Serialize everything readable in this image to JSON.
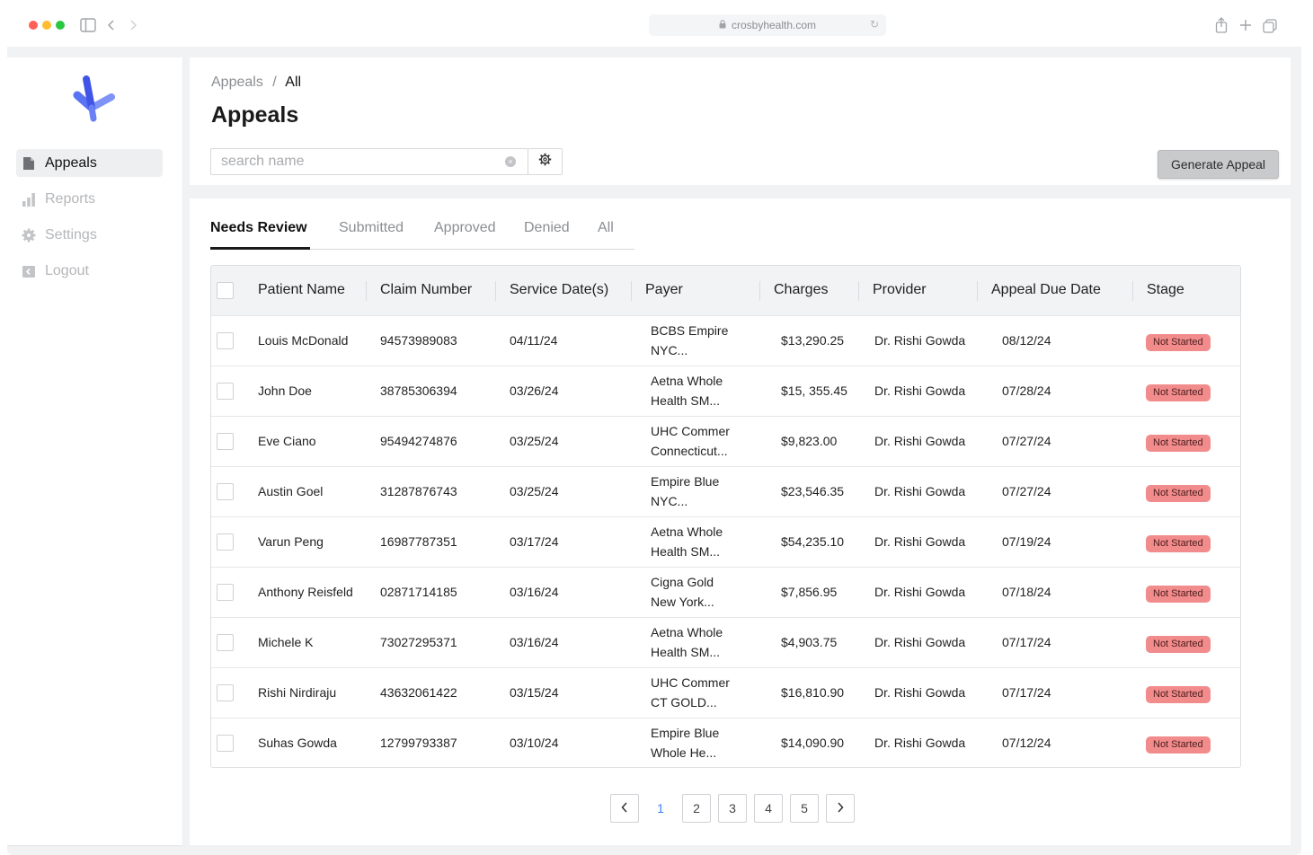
{
  "browser": {
    "url": "crosbyhealth.com"
  },
  "sidebar": {
    "items": [
      {
        "label": "Appeals",
        "icon": "file-icon",
        "active": true
      },
      {
        "label": "Reports",
        "icon": "bar-chart-icon"
      },
      {
        "label": "Settings",
        "icon": "gear-icon"
      },
      {
        "label": "Logout",
        "icon": "logout-icon"
      }
    ]
  },
  "header": {
    "breadcrumb": {
      "parent": "Appeals",
      "separator": "/",
      "current": "All"
    },
    "title": "Appeals",
    "search": {
      "placeholder": "search name",
      "value": ""
    },
    "generate_label": "Generate Appeal"
  },
  "tabs": [
    "Needs Review",
    "Submitted",
    "Approved",
    "Denied",
    "All"
  ],
  "active_tab": "Needs Review",
  "table": {
    "columns": [
      "Patient Name",
      "Claim Number",
      "Service Date(s)",
      "Payer",
      "Charges",
      "Provider",
      "Appeal Due Date",
      "Stage"
    ],
    "rows": [
      {
        "patient": "Louis McDonald",
        "claim": "94573989083",
        "service": "04/11/24",
        "payer": "BCBS Empire\nNYC...",
        "charges": "$13,290.25",
        "provider": "Dr. Rishi Gowda",
        "due": "08/12/24",
        "stage": "Not Started"
      },
      {
        "patient": "John Doe",
        "claim": "38785306394",
        "service": "03/26/24",
        "payer": "Aetna Whole\nHealth SM...",
        "charges": "$15, 355.45",
        "provider": "Dr. Rishi Gowda",
        "due": "07/28/24",
        "stage": "Not Started"
      },
      {
        "patient": "Eve Ciano",
        "claim": "95494274876",
        "service": "03/25/24",
        "payer": "UHC Commer\nConnecticut...",
        "charges": "$9,823.00",
        "provider": "Dr. Rishi Gowda",
        "due": "07/27/24",
        "stage": "Not Started"
      },
      {
        "patient": "Austin Goel",
        "claim": "31287876743",
        "service": "03/25/24",
        "payer": "Empire Blue\nNYC...",
        "charges": "$23,546.35",
        "provider": "Dr. Rishi Gowda",
        "due": "07/27/24",
        "stage": "Not Started"
      },
      {
        "patient": "Varun Peng",
        "claim": "16987787351",
        "service": "03/17/24",
        "payer": "Aetna Whole\nHealth SM...",
        "charges": "$54,235.10",
        "provider": "Dr. Rishi Gowda",
        "due": "07/19/24",
        "stage": "Not Started"
      },
      {
        "patient": "Anthony Reisfeld",
        "claim": "02871714185",
        "service": "03/16/24",
        "payer": "Cigna Gold\nNew York...",
        "charges": "$7,856.95",
        "provider": "Dr. Rishi Gowda",
        "due": "07/18/24",
        "stage": "Not Started"
      },
      {
        "patient": "Michele K",
        "claim": "73027295371",
        "service": "03/16/24",
        "payer": "Aetna Whole\nHealth SM...",
        "charges": "$4,903.75",
        "provider": "Dr. Rishi Gowda",
        "due": "07/17/24",
        "stage": "Not Started"
      },
      {
        "patient": "Rishi Nirdiraju",
        "claim": "43632061422",
        "service": "03/15/24",
        "payer": "UHC Commer\nCT GOLD...",
        "charges": "$16,810.90",
        "provider": "Dr. Rishi Gowda",
        "due": "07/17/24",
        "stage": "Not Started"
      },
      {
        "patient": "Suhas Gowda",
        "claim": "12799793387",
        "service": "03/10/24",
        "payer": "Empire Blue\nWhole He...",
        "charges": "$14,090.90",
        "provider": "Dr. Rishi Gowda",
        "due": "07/12/24",
        "stage": "Not Started"
      }
    ]
  },
  "pagination": {
    "pages": [
      "1",
      "2",
      "3",
      "4",
      "5"
    ],
    "current": "1",
    "prev": "<",
    "next": ">"
  },
  "colors": {
    "accent": "#3b82f6",
    "badge": "#f28b8b",
    "logo": "#4f6bf0"
  }
}
